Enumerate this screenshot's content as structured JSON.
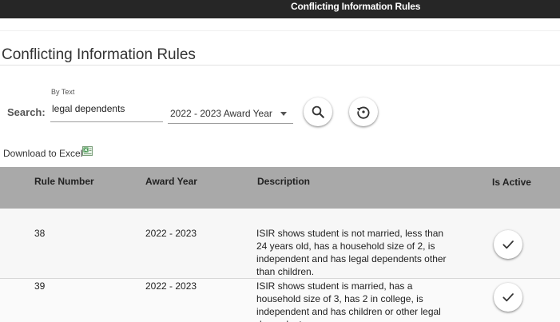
{
  "header": {
    "title": "Conflicting Information Rules",
    "bar_color": "#262626"
  },
  "page": {
    "title": "Conflicting Information Rules"
  },
  "search": {
    "label": "Search:",
    "by_label": "By Text",
    "value": "legal dependents",
    "year_selected": "2022 - 2023 Award Year",
    "search_button_icon": "search-icon",
    "reset_button_icon": "reset-history-icon"
  },
  "download": {
    "label": "Download to Excel",
    "icon": "excel-icon"
  },
  "table": {
    "header_color": "#a9a9a9",
    "columns": {
      "rule_number": "Rule Number",
      "award_year": "Award Year",
      "description": "Description",
      "is_active": "Is Active"
    },
    "rows": [
      {
        "rule_number": "38",
        "award_year": "2022 - 2023",
        "description": "ISIR shows student is not married, less than 24 years old, has a household size of 2, is independent and has legal dependents other than children.",
        "is_active_icon": "checkmark-icon"
      },
      {
        "rule_number": "39",
        "award_year": "2022 - 2023",
        "description": "ISIR shows student is married, has a household size of 3, has 2 in college, is independent and has children or other legal dependents.",
        "is_active_icon": "checkmark-icon"
      }
    ]
  }
}
